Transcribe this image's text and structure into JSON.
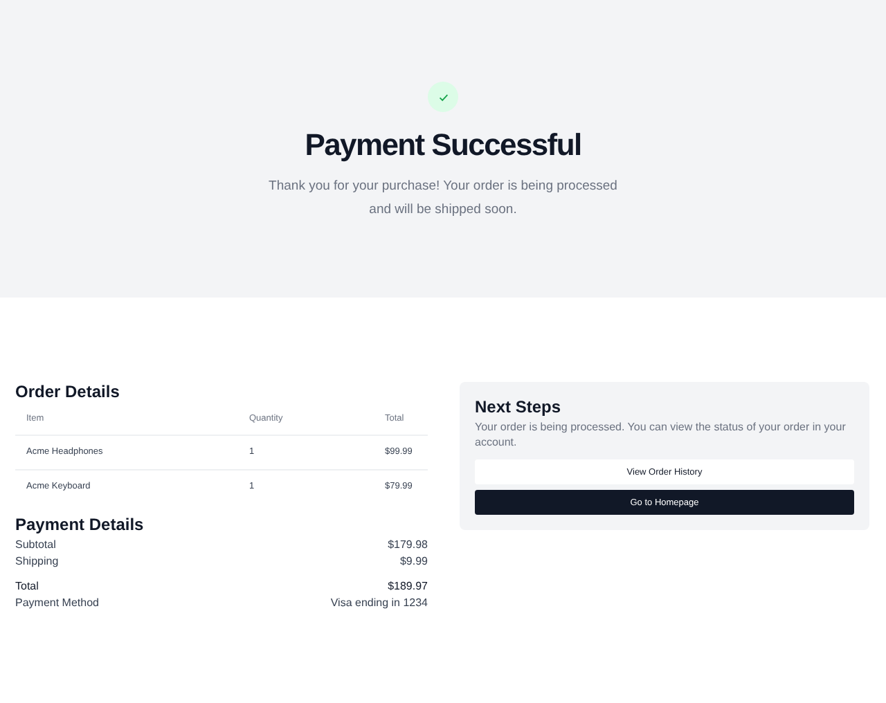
{
  "hero": {
    "title": "Payment Successful",
    "message": "Thank you for your purchase! Your order is being processed and will be shipped soon."
  },
  "order_details": {
    "title": "Order Details",
    "columns": [
      "Item",
      "Quantity",
      "Total"
    ],
    "rows": [
      [
        "Acme Headphones",
        "1",
        "$99.99"
      ],
      [
        "Acme Keyboard",
        "1",
        "$79.99"
      ]
    ]
  },
  "payment_details": {
    "title": "Payment Details",
    "rows": [
      {
        "kind": "line",
        "label": "Subtotal",
        "value": "$179.98"
      },
      {
        "kind": "line",
        "label": "Shipping",
        "value": "$9.99"
      },
      {
        "kind": "total",
        "label": "Total",
        "value": "$189.97"
      },
      {
        "kind": "line",
        "label": "Payment Method",
        "value": "Visa ending in 1234"
      }
    ]
  },
  "next_steps": {
    "title": "Next Steps",
    "text": "Your order is being processed. You can view the status of your order in your account.",
    "buttons": [
      {
        "kind": "secondary",
        "label": "View Order History"
      },
      {
        "kind": "primary",
        "label": "Go to Homepage"
      }
    ]
  }
}
